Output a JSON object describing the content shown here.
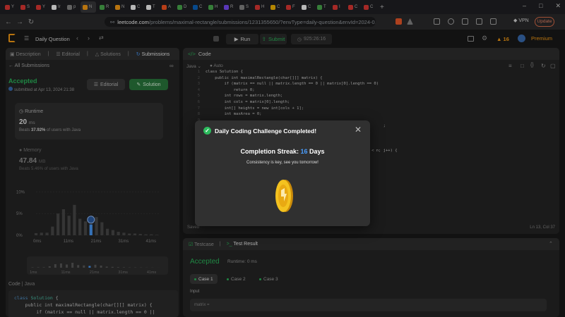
{
  "browser": {
    "tabs": [
      {
        "label": "Y",
        "color": "#e53935"
      },
      {
        "label": "S",
        "color": "#e53935"
      },
      {
        "label": "Y",
        "color": "#e53935"
      },
      {
        "label": "Ir",
        "color": "#ffffff"
      },
      {
        "label": "p",
        "color": "#888888"
      },
      {
        "label": "N",
        "color": "#ffa116",
        "active": true
      },
      {
        "label": "R",
        "color": "#4caf50"
      },
      {
        "label": "N",
        "color": "#ffa116"
      },
      {
        "label": "C",
        "color": "#ffffff"
      },
      {
        "label": "T",
        "color": "#ffffff"
      },
      {
        "label": "A",
        "color": "#ff5722"
      },
      {
        "label": "D",
        "color": "#4caf50"
      },
      {
        "label": "C",
        "color": "#0a66c2"
      },
      {
        "label": "H",
        "color": "#4caf50"
      },
      {
        "label": "R",
        "color": "#7c4dff"
      },
      {
        "label": "S",
        "color": "#888888"
      },
      {
        "label": "H",
        "color": "#e53935"
      },
      {
        "label": "C",
        "color": "#fbbc04"
      },
      {
        "label": "F",
        "color": "#e53935"
      },
      {
        "label": "C",
        "color": "#ffffff"
      },
      {
        "label": "T",
        "color": "#4caf50"
      },
      {
        "label": "I",
        "color": "#e53935"
      },
      {
        "label": "C",
        "color": "#e53935"
      },
      {
        "label": "C",
        "color": "#e53935"
      }
    ],
    "url_host": "leetcode.com",
    "url_path": "/problems/maximal-rectangle/submissions/1231355650/?envType=daily-question&envId=2024-0...",
    "vpn_label": "VPN",
    "update_label": "Update"
  },
  "lc": {
    "problem_list": "Daily Question",
    "run_label": "Run",
    "submit_label": "Submit",
    "timer": "925:26:16",
    "streak_count": "16",
    "premium_label": "Premium"
  },
  "left": {
    "tabs": [
      "Description",
      "Editorial",
      "Solutions",
      "Submissions"
    ],
    "all_submissions": "All Submissions",
    "status": "Accepted",
    "submitted_at": "submitted at Apr 13, 2024 21:38",
    "editorial_btn": "Editorial",
    "solution_btn": "Solution",
    "runtime_label": "Runtime",
    "runtime_value": "20",
    "runtime_unit": "ms",
    "runtime_beats_prefix": "Beats",
    "runtime_beats_pct": "37.92%",
    "runtime_beats_suffix": "of users with Java",
    "memory_label": "Memory",
    "memory_value": "47.84",
    "memory_unit": "MB",
    "memory_beats": "Beats 5.46% of users with Java",
    "chart_y_labels": [
      "10%",
      "5%",
      "0%"
    ],
    "chart_x_labels": [
      "0ms",
      "11ms",
      "21ms",
      "31ms",
      "41ms"
    ],
    "mini_x_labels": [
      "1ms",
      "11ms",
      "21ms",
      "31ms",
      "41ms"
    ],
    "code_label": "Code",
    "code_lang": "Java",
    "code_lines": [
      "class Solution {",
      "    public int maximalRectangle(char[][] matrix) {",
      "        if (matrix == null || matrix.length == 0 || "
    ]
  },
  "chart_data": {
    "type": "bar",
    "title": "",
    "xlabel": "Runtime",
    "ylabel": "",
    "ylim": [
      0,
      12
    ],
    "x": [
      0,
      2,
      4,
      6,
      8,
      10,
      12,
      14,
      16,
      18,
      20,
      22,
      24,
      26,
      28,
      30,
      32,
      34,
      36,
      38,
      40,
      42,
      44
    ],
    "values": [
      0.5,
      0.6,
      0.6,
      2.0,
      5.0,
      6.0,
      4.5,
      7.0,
      3.8,
      3.2,
      2.5,
      4.2,
      3.0,
      1.5,
      1.2,
      0.8,
      0.6,
      0.4,
      0.4,
      0.3,
      0.2,
      0.2,
      0.1
    ],
    "highlight_x": 20
  },
  "editor": {
    "title": "Code",
    "language": "Java",
    "mode": "Auto",
    "saved": "Saved",
    "cursor": "Ln 13, Col 37",
    "lines": [
      "class Solution {",
      "    public int maximalRectangle(char[][] matrix) {",
      "        if (matrix == null || matrix.length == 0 || matrix[0].length == 0)",
      "            return 0;",
      "        int rows = matrix.length;",
      "        int cols = matrix[0].length;",
      "        int[] heights = new int[cols + 1];",
      "        int maxArea = 0;",
      "",
      "                                                                            ;",
      "",
      "",
      "",
      "                                                                       < n; j++) {",
      "",
      "",
      "",
      "",
      "",
      "",
      "",
      "",
      "",
      "",
      "",
      ""
    ]
  },
  "testpanel": {
    "tabs": [
      "Testcase",
      "Test Result"
    ],
    "status": "Accepted",
    "runtime": "Runtime: 0 ms",
    "cases": [
      "Case 1",
      "Case 2",
      "Case 3"
    ],
    "input_label": "Input",
    "input_value": "matrix ="
  },
  "modal": {
    "title": "Daily Coding Challenge Completed!",
    "streak_prefix": "Completion Streak:",
    "streak_value": "16",
    "streak_suffix": "Days",
    "message": "Consistency is key, see you tomorrow!"
  }
}
